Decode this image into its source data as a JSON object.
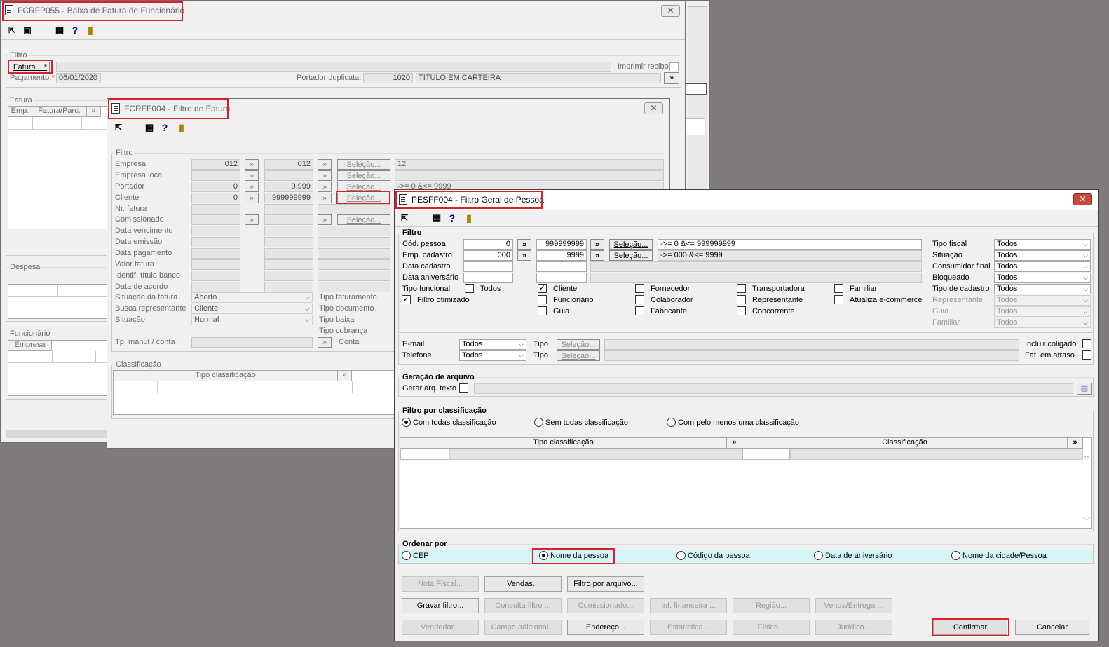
{
  "win1": {
    "title": "FCRFP055 - Baixa de Fatura de Funcionário",
    "filtro_legend": "Filtro",
    "fatura_btn": "Fatura... *",
    "imprimir_recibo": "Imprimir recibo",
    "pagamento_label": "Pagamento *",
    "pagamento_value": "06/01/2020",
    "portador_label": "Portador duplicata:",
    "portador_code": "1020",
    "portador_name": "TITULO EM CARTEIRA",
    "fatura_legend": "Fatura",
    "fatura_cols": [
      "Emp.",
      "Fatura/Parc."
    ],
    "despesa_legend": "Despesa",
    "funcionario_legend": "Funcionário",
    "func_cols": [
      "Empresa"
    ]
  },
  "win2": {
    "title": "FCRFF004 - Filtro de Fatura",
    "filtro_legend": "Filtro",
    "labels": [
      "Empresa",
      "Empresa local",
      "Portador",
      "Cliente",
      "Nr. fatura",
      "Comissionado",
      "Data vencimento",
      "Data emissão",
      "Data pagamento",
      "Valor fatura",
      "Identif. título banco",
      "Data de acordo",
      "Situação da fatura",
      "Busca representante",
      "Situação"
    ],
    "empresa_from": "012",
    "empresa_to": "012",
    "empresa_desc": "12",
    "portador_from": "0",
    "portador_to": "9.999",
    "portador_desc": "->= 0 &<= 9999",
    "cliente_from": "0",
    "cliente_to": "999999999",
    "selecao": "Seleção...",
    "situacao_fatura": "Aberto",
    "busca_representante": "Cliente",
    "situacao": "Normal",
    "right_labels": [
      "Tipo faturamento",
      "Tipo documento",
      "Tipo baixa",
      "Tipo cobrança"
    ],
    "tp_manut": "Tp. manut / conta",
    "conta": "Conta",
    "classificacao_legend": "Classificação",
    "tipo_classificacao": "Tipo classificação"
  },
  "win3": {
    "title": "PESFF004 - Filtro Geral de Pessoa",
    "filtro_legend": "Filtro",
    "cod_pessoa": "Cód. pessoa",
    "cod_from": "0",
    "cod_to": "999999999",
    "cod_desc": "->= 0 &<= 999999999",
    "emp_cadastro": "Emp. cadastro",
    "emp_from": "000",
    "emp_to": "9999",
    "emp_desc": "->= 000 &<= 9999",
    "data_cadastro": "Data cadastro",
    "data_aniversario": "Data aniversário",
    "selecao": "Seleção...",
    "tipo_funcional": "Tipo funcional",
    "todos": "Todos",
    "filtro_otimizado": "Filtro otimizado",
    "checks": {
      "cliente": "Cliente",
      "funcionario": "Funcionário",
      "guia": "Guia",
      "fornecedor": "Fornecedor",
      "colaborador": "Colaborador",
      "fabricante": "Fabricante",
      "transportadora": "Transportadora",
      "representante": "Representante",
      "concorrente": "Concorrente",
      "familiar": "Familiar",
      "atualiza": "Atualiza e-commerce"
    },
    "right": [
      {
        "label": "Tipo fiscal",
        "value": "Todos"
      },
      {
        "label": "Situação",
        "value": "Todos"
      },
      {
        "label": "Consumidor final",
        "value": "Todos"
      },
      {
        "label": "Bloqueado",
        "value": "Todos"
      },
      {
        "label": "Tipo de cadastro",
        "value": "Todos"
      },
      {
        "label": "Representante",
        "value": "Todos"
      },
      {
        "label": "Guia",
        "value": "Todos"
      },
      {
        "label": "Familiar",
        "value": "Todos"
      }
    ],
    "email": "E-mail",
    "email_value": "Todos",
    "telefone": "Telefone",
    "telefone_value": "Todos",
    "tipo": "Tipo",
    "incluir_coligado": "Incluir coligado",
    "fat_atraso": "Fat. em atraso",
    "geracao_legend": "Geração de arquivo",
    "gerar_arq": "Gerar arq. texto",
    "filtro_class_legend": "Filtro por classificação",
    "radios": [
      "Com todas classificação",
      "Sem todas classificação",
      "Com pelo menos uma classificação"
    ],
    "grid_cols": [
      "Tipo classificação",
      "Classificação"
    ],
    "ordenar_legend": "Ordenar por",
    "order": [
      "CEP",
      "Nome da pessoa",
      "Código da pessoa",
      "Data de aniversário",
      "Nome da cidade/Pessoa"
    ],
    "buttons_row1": [
      "Nota Fiscal...",
      "Vendas...",
      "Filtro por arquivo..."
    ],
    "buttons_row2": [
      "Gravar filtro...",
      "Consulta filtro ...",
      "Comissionado...",
      "Inf. financeira ...",
      "Região...",
      "Venda/Entrega ..."
    ],
    "buttons_row3": [
      "Vendedor...",
      "Campo adicional...",
      "Endereço...",
      "Estatística...",
      "Físico...",
      "Jurídico..."
    ],
    "confirmar": "Confirmar",
    "cancelar": "Cancelar"
  }
}
